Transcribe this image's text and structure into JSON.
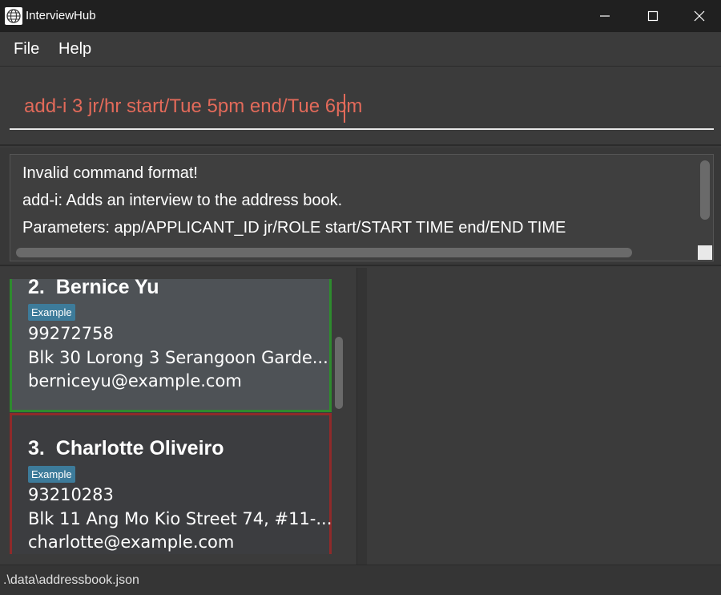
{
  "window": {
    "title": "InterviewHub",
    "icon": "globe-icon",
    "controls": [
      "minimize-icon",
      "maximize-icon",
      "close-icon"
    ]
  },
  "menu": {
    "file": "File",
    "help": "Help"
  },
  "command": {
    "value": "add-i 3 jr/hr start/Tue 5pm end/Tue 6pm",
    "text_color": "#e36a5a"
  },
  "result": {
    "lines": [
      "Invalid command format!",
      "add-i: Adds an interview to the address book.",
      "Parameters: app/APPLICANT_ID jr/ROLE start/START TIME end/END TIME"
    ]
  },
  "people": [
    {
      "index": "2.",
      "name": "Bernice Yu",
      "tag": "Example",
      "phone": "99272758",
      "address": "Blk 30 Lorong 3 Serangoon Garde...",
      "email": "berniceyu@example.com",
      "border_color": "#2e8b2e"
    },
    {
      "index": "3.",
      "name": "Charlotte Oliveiro",
      "tag": "Example",
      "phone": "93210283",
      "address": "Blk 11 Ang Mo Kio Street 74, #11-...",
      "email": "charlotte@example.com",
      "border_color": "#8f2a2a"
    }
  ],
  "status": {
    "path": ".\\data\\addressbook.json"
  }
}
